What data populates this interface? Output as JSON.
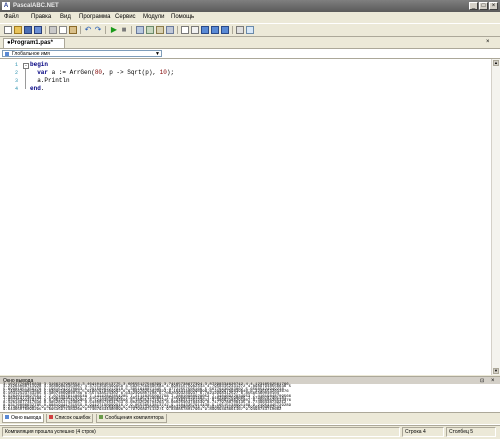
{
  "window": {
    "title": "PascalABC.NET",
    "app_icon_text": "A"
  },
  "menu": [
    "Файл",
    "Правка",
    "Вид",
    "Программа",
    "Сервис",
    "Модули",
    "Помощь"
  ],
  "tabs": [
    {
      "label": "●Program1.pas*"
    }
  ],
  "scope_combo": {
    "value": "Глобальное имя"
  },
  "editor": {
    "line_numbers": [
      "1",
      "2",
      "3",
      "4"
    ],
    "lines": [
      {
        "kw": "begin",
        "rest": ""
      },
      {
        "kw": "  var",
        "rest": " a := ArrGen(",
        "num1": "80",
        "mid": ", p -> Sqrt(p), ",
        "num2": "10",
        "end": ");"
      },
      {
        "kw": "",
        "rest": "  a.Println"
      },
      {
        "kw": "end",
        "rest": "."
      }
    ]
  },
  "output": {
    "title": "Окно вывода",
    "lines": [
      "3.16227766016838 3.3166247903554 3.46410161513775 3.60555127546399 3.74165738677394 3.87298334620742 4 4.12310562561766",
      "4.24264068711928 4.35889894354067 4.47213595499958 4.58257569495584 4.69041575982343 4.79583152331272 4.89897948556636 5",
      "5.09901951359278 5.19615242270663 5.29150262212918 5.3851648071345 5.47722557505166 5.56776436283002 5.65685424949238",
      "5.74456264653803 5.8309518948453 5.91607978309962 6 6.08276253029822 6.16441400296898 6.24499799839840 6.32455532033676",
      "6.40312423743285 6.48074069840786 6.557438524302 6.6332495807108 6.70820393249937 6.78232998312527 6.85565460040104",
      "6.92820323027551 7 7.07106781186548 7.14142842854285 7.21110255092798 7.28010988928052 7.34846922834953 7.41619848709566",
      "7.48331477354788 7.54983443527075 7.61577310586391 7.68114574786861 7.74596669241483 7.81024967590665 7.87400787401181",
      "7.93725393319377 8 8.06225774829855 8.12403840463596 8.18535277187245 8.24621125123532 8.30662386291807 8.36660026534076",
      "8.42614977317636 8.48528137423857 8.54400374531753 8.60232526704263 8.66025403784439 8.71779788708135 8.77496438739212",
      "8.83176086632785 8.88819441731559 8.94427190999916 9 9.05538513813742 9.11043357914430 9.16515138991168 9.21954445729289",
      "9.2736184954957 9.32737905308882 9.38083151964686 9.4339811320566 9.48683298050514 9.53939201416946 9.59166304662544",
      "9.64365076099295 9.69535971483266 9.74679434480896 9.79795897113271 9.8488578017961 9.89949493661167 9.9498743710662"
    ]
  },
  "bottom_tabs": [
    "Окно вывода",
    "Список ошибок",
    "Сообщения компилятора"
  ],
  "status": {
    "message": "Компиляция прошла успешно (4 строк)",
    "row_label": "Строка",
    "row": "4",
    "col_label": "Столбец",
    "col": "5"
  }
}
